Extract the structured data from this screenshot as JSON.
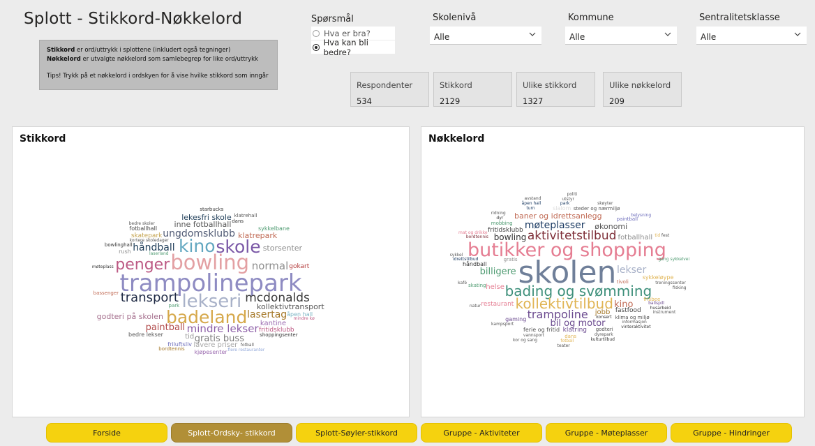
{
  "title": "Splott - Stikkord-Nøkkelord",
  "info": {
    "line1_bold": "Stikkord",
    "line1_rest": " er ord/uttrykk i splottene (inkludert også tegninger)",
    "line2_bold": "Nøkkelord",
    "line2_rest": " er utvalgte nøkkelord som samlebegrep for like ord/uttrykk",
    "tip": "Tips! Trykk på et nøkkelord i ordskyen for å vise hvilke stikkord som inngår"
  },
  "question": {
    "label": "Spørsmål",
    "options": [
      {
        "label": "Hva er bra?",
        "selected": false
      },
      {
        "label": "Hva kan bli bedre?",
        "selected": true
      }
    ]
  },
  "filters": [
    {
      "label": "Skolenivå",
      "value": "Alle"
    },
    {
      "label": "Kommune",
      "value": "Alle"
    },
    {
      "label": "Sentralitetsklasse",
      "value": "Alle"
    }
  ],
  "kpis": [
    {
      "label": "Respondenter",
      "value": "534"
    },
    {
      "label": "Stikkord",
      "value": "2129"
    },
    {
      "label": "Ulike stikkord",
      "value": "1327"
    },
    {
      "label": "Ulike nøkkelord",
      "value": "209"
    }
  ],
  "stikkord": {
    "title": "Stikkord",
    "words": [
      {
        "t": "trampolinepark",
        "c": "#8e8bc2",
        "s": 34
      },
      {
        "t": "badeland",
        "c": "#d6a84a",
        "s": 25
      },
      {
        "t": "lekseri",
        "c": "#a8b1c8",
        "s": 26
      },
      {
        "t": "bowling",
        "c": "#e3a0a3",
        "s": 29
      },
      {
        "t": "kino",
        "c": "#62a7c0",
        "s": 25
      },
      {
        "t": "skole",
        "c": "#7a57a6",
        "s": 25
      },
      {
        "t": "penger",
        "c": "#bc5a84",
        "s": 22
      },
      {
        "t": "transport",
        "c": "#1f2a44",
        "s": 18
      },
      {
        "t": "mcdonalds",
        "c": "#3a3a3a",
        "s": 17
      },
      {
        "t": "normal",
        "c": "#8e8e8e",
        "s": 15
      },
      {
        "t": "mindre lekser",
        "c": "#8e61a9",
        "s": 15
      },
      {
        "t": "ungdomsklubb",
        "c": "#505a74",
        "s": 14
      },
      {
        "t": "lasertag",
        "c": "#a57828",
        "s": 14
      },
      {
        "t": "håndball",
        "c": "#1e3d58",
        "s": 14
      },
      {
        "t": "gratis buss",
        "c": "#7d7d7d",
        "s": 13
      },
      {
        "t": "paintball",
        "c": "#b04848",
        "s": 13
      },
      {
        "t": "inne fotballhall",
        "c": "#555",
        "s": 11
      },
      {
        "t": "kollektivtransport",
        "c": "#555",
        "s": 11
      },
      {
        "t": "godteri på skolen",
        "c": "#a56f8d",
        "s": 11
      },
      {
        "t": "klatrepark",
        "c": "#c06a54",
        "s": 11
      },
      {
        "t": "storsenter",
        "c": "#8c8c8c",
        "s": 11
      },
      {
        "t": "lekesfri skole",
        "c": "#1e3d58",
        "s": 11
      },
      {
        "t": "kantine",
        "c": "#9b6bb0",
        "s": 10
      },
      {
        "t": "tid",
        "c": "#999",
        "s": 10
      },
      {
        "t": "lavere priser",
        "c": "#aaa",
        "s": 10
      },
      {
        "t": "skatepark",
        "c": "#c4a34e",
        "s": 9
      },
      {
        "t": "gokart",
        "c": "#b33a3a",
        "s": 9
      },
      {
        "t": "fritidsklubb",
        "c": "#bc5a84",
        "s": 9
      },
      {
        "t": "sykkelbane",
        "c": "#4d9a70",
        "s": 8
      },
      {
        "t": "bedre lekser",
        "c": "#555",
        "s": 8
      },
      {
        "t": "friluftsliv",
        "c": "#6d6dbb",
        "s": 8
      },
      {
        "t": "fotballhall",
        "c": "#444",
        "s": 8
      },
      {
        "t": "åpen hall",
        "c": "#7bb5c4",
        "s": 8
      },
      {
        "t": "kjøpesenter",
        "c": "#9b6bb0",
        "s": 8
      },
      {
        "t": "rush",
        "c": "#8c8c8c",
        "s": 8
      },
      {
        "t": "shoppingsenter",
        "c": "#333",
        "s": 7
      },
      {
        "t": "klatrehall",
        "c": "#555",
        "s": 7
      },
      {
        "t": "bassenger",
        "c": "#c06a54",
        "s": 7
      },
      {
        "t": "park",
        "c": "#4d9a70",
        "s": 7
      },
      {
        "t": "dans",
        "c": "#333",
        "s": 7
      },
      {
        "t": "bowlinghall",
        "c": "#333",
        "s": 7
      },
      {
        "t": "starbucks",
        "c": "#333",
        "s": 7
      },
      {
        "t": "bordtennis",
        "c": "#a57828",
        "s": 7
      },
      {
        "t": "kortere skoledager",
        "c": "#555",
        "s": 6
      },
      {
        "t": "flere restauranter",
        "c": "#8fa6d8",
        "s": 6
      },
      {
        "t": "laserland",
        "c": "#4d9a70",
        "s": 6
      },
      {
        "t": "mindre kø",
        "c": "#bc5a84",
        "s": 6
      },
      {
        "t": "bedre skoler",
        "c": "#555",
        "s": 6
      },
      {
        "t": "møteplass",
        "c": "#333",
        "s": 6
      },
      {
        "t": "fotball",
        "c": "#555",
        "s": 6
      }
    ]
  },
  "nokkelord": {
    "title": "Nøkkelord",
    "words": [
      {
        "t": "skolen",
        "c": "#6f7f99",
        "s": 44
      },
      {
        "t": "butikker og shopping",
        "c": "#e57d92",
        "s": 27
      },
      {
        "t": "bading og svømming",
        "c": "#3d8f7a",
        "s": 20
      },
      {
        "t": "kollektivtilbud",
        "c": "#e0b453",
        "s": 20
      },
      {
        "t": "aktivitetstilbud",
        "c": "#7d2d37",
        "s": 17
      },
      {
        "t": "trampoline",
        "c": "#6b4a8f",
        "s": 16
      },
      {
        "t": "bil og motor",
        "c": "#6b4a8f",
        "s": 13
      },
      {
        "t": "møteplasser",
        "c": "#1a3a62",
        "s": 14
      },
      {
        "t": "billigere",
        "c": "#4d9a70",
        "s": 13
      },
      {
        "t": "lekser",
        "c": "#a8b1c8",
        "s": 14
      },
      {
        "t": "bowling",
        "c": "#333",
        "s": 12
      },
      {
        "t": "kino",
        "c": "#c06a54",
        "s": 13
      },
      {
        "t": "baner og idrettsanlegg",
        "c": "#c06a54",
        "s": 11
      },
      {
        "t": "økonomi",
        "c": "#555",
        "s": 11
      },
      {
        "t": "fotballhall",
        "c": "#8e8e8e",
        "s": 10
      },
      {
        "t": "jobb",
        "c": "#a57828",
        "s": 10
      },
      {
        "t": "restaurant",
        "c": "#e57d92",
        "s": 9
      },
      {
        "t": "fritidsklubb",
        "c": "#444",
        "s": 9
      },
      {
        "t": "helse",
        "c": "#e57d92",
        "s": 10
      },
      {
        "t": "fastfood",
        "c": "#444",
        "s": 9
      },
      {
        "t": "klatring",
        "c": "#6b4a8f",
        "s": 9
      },
      {
        "t": "gaming",
        "c": "#6b4a8f",
        "s": 8
      },
      {
        "t": "sykkeløype",
        "c": "#e0b453",
        "s": 8
      },
      {
        "t": "ferie og fritid",
        "c": "#555",
        "s": 8
      },
      {
        "t": "steder og nærmiljø",
        "c": "#555",
        "s": 7
      },
      {
        "t": "håndball",
        "c": "#333",
        "s": 8
      },
      {
        "t": "slalom",
        "c": "#ddd",
        "s": 8
      },
      {
        "t": "skating",
        "c": "#4d9a70",
        "s": 7
      },
      {
        "t": "frisbee",
        "c": "#e0b453",
        "s": 7
      },
      {
        "t": "tivoli",
        "c": "#c06a54",
        "s": 7
      },
      {
        "t": "klima og miljø",
        "c": "#555",
        "s": 7
      },
      {
        "t": "konsert",
        "c": "#333",
        "s": 6
      },
      {
        "t": "turn",
        "c": "#1a3a62",
        "s": 6
      },
      {
        "t": "park",
        "c": "#1a3a62",
        "s": 6
      },
      {
        "t": "godteri",
        "c": "#555",
        "s": 7
      },
      {
        "t": "gratis",
        "c": "#8e8e8e",
        "s": 7
      },
      {
        "t": "mobbing",
        "c": "#4d9a70",
        "s": 7
      },
      {
        "t": "paintball",
        "c": "#6d6dbb",
        "s": 7
      },
      {
        "t": "ballspill",
        "c": "#6b4a8f",
        "s": 6
      },
      {
        "t": "informasjon",
        "c": "#555",
        "s": 6
      },
      {
        "t": "dyrepark",
        "c": "#555",
        "s": 6
      },
      {
        "t": "vannsport",
        "c": "#555",
        "s": 6
      },
      {
        "t": "kampsport",
        "c": "#555",
        "s": 6
      },
      {
        "t": "idrettstilbud",
        "c": "#1a3a62",
        "s": 6
      },
      {
        "t": "bordtennis",
        "c": "#7d2d37",
        "s": 6
      },
      {
        "t": "dans",
        "c": "#e0b453",
        "s": 7
      },
      {
        "t": "dyr",
        "c": "#333",
        "s": 6
      },
      {
        "t": "treningssenter",
        "c": "#555",
        "s": 6
      },
      {
        "t": "fotball",
        "c": "#e0b453",
        "s": 6
      },
      {
        "t": "åpen hall",
        "c": "#1a3a62",
        "s": 6
      },
      {
        "t": "tid",
        "c": "#e0b453",
        "s": 6
      },
      {
        "t": "utstyr",
        "c": "#555",
        "s": 6
      },
      {
        "t": "skøyter",
        "c": "#555",
        "s": 6
      },
      {
        "t": "gang sykkelvei",
        "c": "#4d9a70",
        "s": 6
      },
      {
        "t": "husarbeid",
        "c": "#333",
        "s": 6
      },
      {
        "t": "vinteraktivitet",
        "c": "#333",
        "s": 6
      },
      {
        "t": "kulturtilbud",
        "c": "#333",
        "s": 6
      },
      {
        "t": "natur",
        "c": "#555",
        "s": 6
      },
      {
        "t": "kafé",
        "c": "#555",
        "s": 6
      },
      {
        "t": "mat og drikke",
        "c": "#e57d92",
        "s": 6
      },
      {
        "t": "ridning",
        "c": "#555",
        "s": 6
      },
      {
        "t": "belysning",
        "c": "#6d6dbb",
        "s": 6
      },
      {
        "t": "fest",
        "c": "#555",
        "s": 6
      },
      {
        "t": "teater",
        "c": "#555",
        "s": 6
      },
      {
        "t": "kor og sang",
        "c": "#555",
        "s": 6
      },
      {
        "t": "sykkel",
        "c": "#555",
        "s": 6
      },
      {
        "t": "avstand",
        "c": "#555",
        "s": 6
      },
      {
        "t": "politi",
        "c": "#555",
        "s": 6
      },
      {
        "t": "fisking",
        "c": "#555",
        "s": 6
      },
      {
        "t": "instrument",
        "c": "#555",
        "s": 6
      }
    ]
  },
  "nav": [
    {
      "label": "Forside",
      "active": false
    },
    {
      "label": "Splott-Ordsky- stikkord",
      "active": true
    },
    {
      "label": "Splott-Søyler-stikkord",
      "active": false
    },
    {
      "label": "Gruppe - Aktiviteter",
      "active": false
    },
    {
      "label": "Gruppe - Møteplasser",
      "active": false
    },
    {
      "label": "Gruppe - Hindringer",
      "active": false
    }
  ]
}
